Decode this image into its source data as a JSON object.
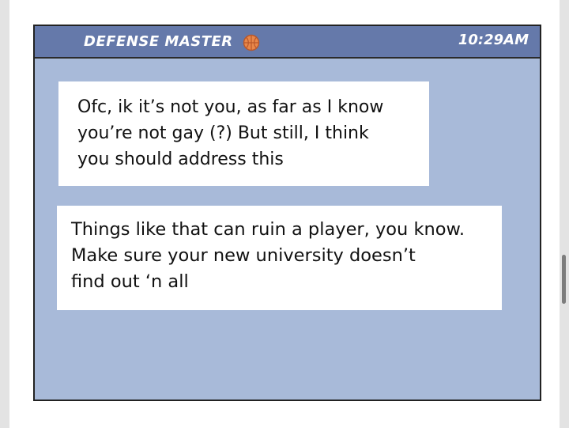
{
  "header": {
    "contact_name": "DEFENSE MASTER",
    "contact_icon": "basketball-icon",
    "time": "10:29AM"
  },
  "messages": [
    {
      "text": "Ofc, ik it’s not you, as far as I know\nyou’re not gay (?) But still, I think\nyou should address this"
    },
    {
      "text": "Things like that can ruin a player, you know.\nMake sure your new university doesn’t\nfind out ‘n all"
    }
  ],
  "colors": {
    "header_bg": "#6579aa",
    "chat_bg": "#a8bad9",
    "bubble_bg": "#ffffff",
    "icon_orange": "#e8874a"
  }
}
